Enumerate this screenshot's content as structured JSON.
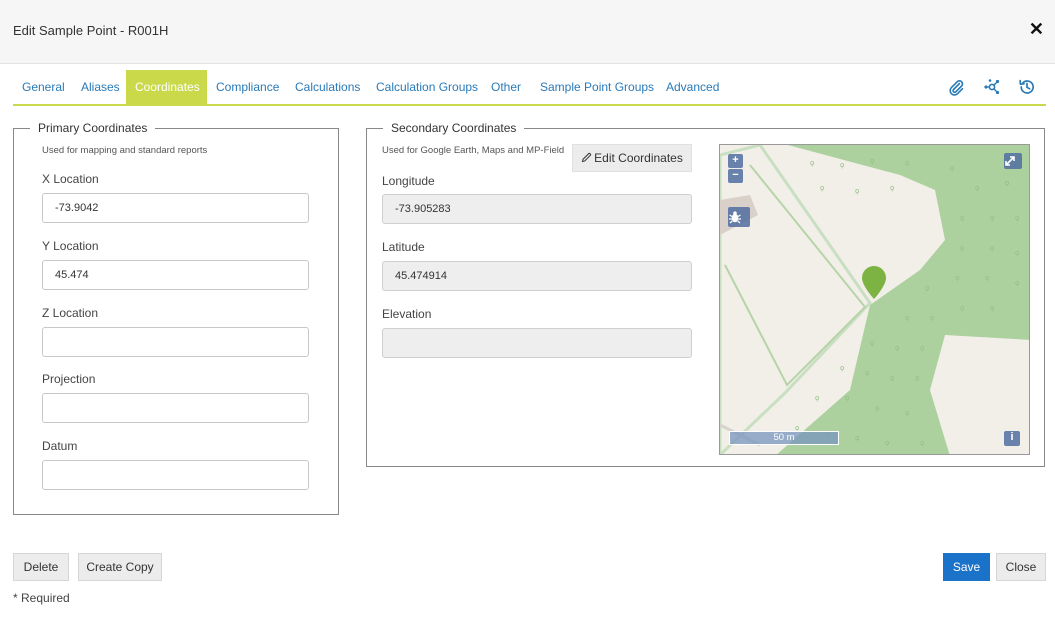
{
  "dialog": {
    "title": "Edit Sample Point - R001H",
    "close_glyph": "✕"
  },
  "tabs": [
    {
      "label": "General",
      "active": false
    },
    {
      "label": "Aliases",
      "active": false
    },
    {
      "label": "Coordinates",
      "active": true
    },
    {
      "label": "Compliance",
      "active": false
    },
    {
      "label": "Calculations",
      "active": false
    },
    {
      "label": "Calculation Groups",
      "active": false
    },
    {
      "label": "Other",
      "active": false
    },
    {
      "label": "Sample Point Groups",
      "active": false
    },
    {
      "label": "Advanced",
      "active": false
    }
  ],
  "tab_icons": [
    "paperclip-icon",
    "network-icon",
    "history-icon"
  ],
  "primary": {
    "legend": "Primary Coordinates",
    "hint": "Used for mapping and standard reports",
    "fields": [
      {
        "label": "X Location",
        "value": "-73.9042"
      },
      {
        "label": "Y Location",
        "value": "45.474"
      },
      {
        "label": "Z Location",
        "value": ""
      },
      {
        "label": "Projection",
        "value": ""
      },
      {
        "label": "Datum",
        "value": ""
      }
    ]
  },
  "secondary": {
    "legend": "Secondary Coordinates",
    "hint": "Used for Google Earth, Maps and MP-Field",
    "edit_button": "Edit Coordinates",
    "fields": [
      {
        "label": "Longitude",
        "value": "-73.905283"
      },
      {
        "label": "Latitude",
        "value": "45.474914"
      },
      {
        "label": "Elevation",
        "value": ""
      }
    ]
  },
  "map": {
    "zoom_in": "+",
    "zoom_out": "−",
    "scale_label": "50 m",
    "info_label": "i",
    "colors": {
      "land": "#f2efe9",
      "forest": "#add19e",
      "marker": "#7cb342"
    }
  },
  "footer": {
    "delete_label": "Delete",
    "copy_label": "Create Copy",
    "save_label": "Save",
    "close_label": "Close",
    "required_note": "* Required"
  },
  "colors": {
    "accent": "#c9d94a",
    "link": "#2a7ab8",
    "primary_button": "#1b72c9"
  }
}
